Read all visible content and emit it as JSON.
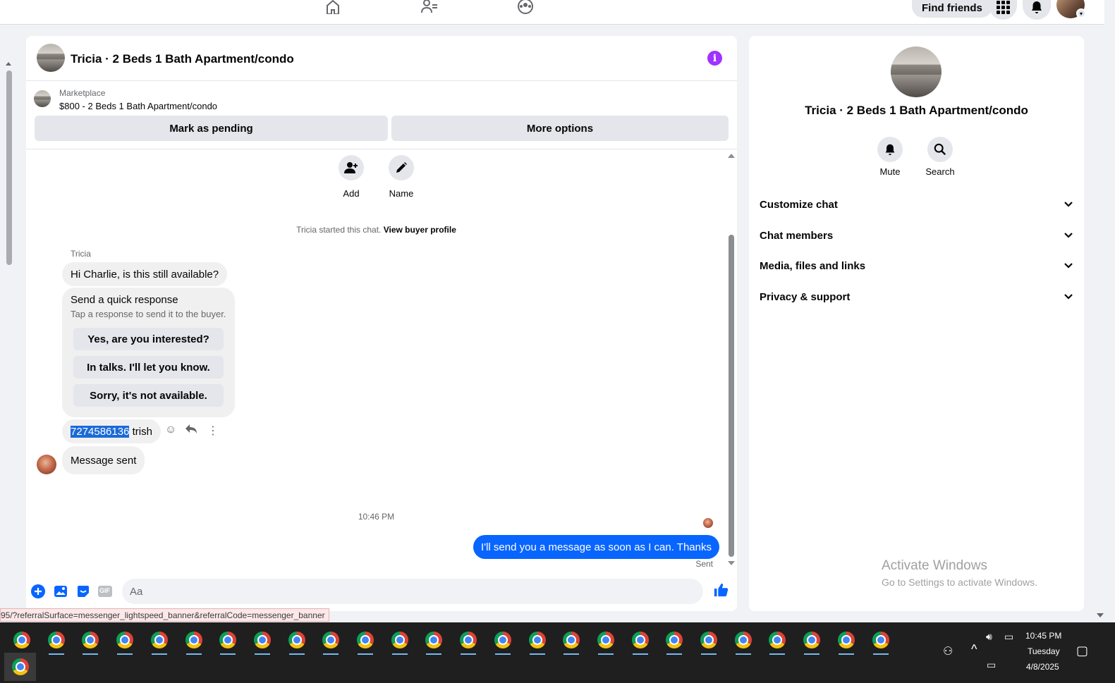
{
  "topbar": {
    "find_friends": "Find friends",
    "nav_icons": [
      "home-icon",
      "friends-icon",
      "groups-icon"
    ],
    "menu_icon": "grid-icon",
    "notifications_icon": "bell-icon"
  },
  "chat": {
    "title": "Tricia · 2 Beds 1 Bath Apartment/condo",
    "marketplace": {
      "label": "Marketplace",
      "item": "$800 - 2 Beds 1 Bath Apartment/condo",
      "mark_pending": "Mark as pending",
      "more_options": "More options"
    },
    "actions": [
      {
        "label": "Add",
        "icon": "add-person-icon"
      },
      {
        "label": "Name",
        "icon": "pencil-icon"
      }
    ],
    "started_text": "Tricia started this chat.",
    "buyer_profile_link": "View buyer profile",
    "sender_name": "Tricia",
    "messages": {
      "first": "Hi Charlie, is this still available?",
      "quick_title": "Send a quick response",
      "quick_sub": "Tap a response to send it to the buyer.",
      "quick_options": [
        "Yes, are you interested?",
        "In talks. I'll let you know.",
        "Sorry, it's not available."
      ],
      "phone_selected": "7274586136",
      "phone_rest": " trish",
      "sent_notice": "Message sent",
      "time": "10:46 PM",
      "mine": "I'll send you a message as soon as I can. Thanks",
      "status": "Sent"
    },
    "composer": {
      "placeholder": "Aa",
      "gif": "GIF"
    }
  },
  "info_panel": {
    "title": "Tricia · 2 Beds 1 Bath Apartment/condo",
    "mute": "Mute",
    "search": "Search",
    "sections": [
      "Customize chat",
      "Chat members",
      "Media, files and links",
      "Privacy & support"
    ],
    "watermark_title": "Activate Windows",
    "watermark_sub": "Go to Settings to activate Windows."
  },
  "status_url": "95/?referralSurface=messenger_lightspeed_banner&referralCode=messenger_banner",
  "taskbar": {
    "time": "10:45 PM",
    "day": "Tuesday",
    "date": "4/8/2025"
  },
  "colors": {
    "accent": "#0866ff",
    "info_purple": "#a033ff"
  }
}
